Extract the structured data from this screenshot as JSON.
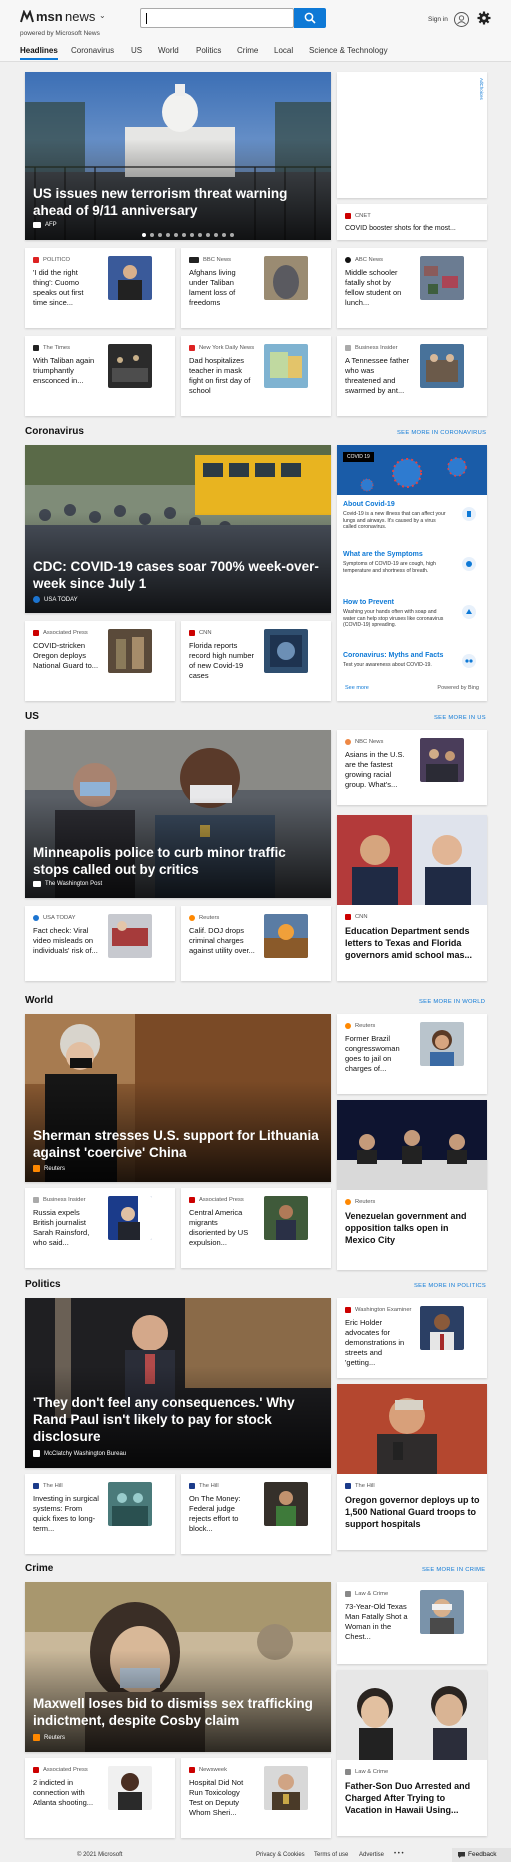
{
  "header": {
    "logo_msn": "msn",
    "logo_news": "news",
    "tagline": "powered by Microsoft News",
    "search": {
      "value": "",
      "placeholder": ""
    },
    "signin": "Sign in",
    "nav": [
      "Headlines",
      "Coronavirus",
      "US",
      "World",
      "Politics",
      "Crime",
      "Local",
      "Science & Technology"
    ]
  },
  "top": {
    "hero": {
      "title": "US issues new terrorism threat warning ahead of 9/11 anniversary",
      "source": "AFP"
    },
    "ad_label": "AdChoices",
    "side": {
      "source": "CNET",
      "title": "COVID booster shots for the most..."
    },
    "small": [
      {
        "source": "POLITICO",
        "title": "'I did the right thing': Cuomo speaks out first time since..."
      },
      {
        "source": "BBC News",
        "title": "Afghans living under Taliban lament loss of freedoms"
      },
      {
        "source": "ABC News",
        "title": "Middle schooler fatally shot by fellow student on lunch..."
      },
      {
        "source": "The Times",
        "title": "With Taliban again triumphantly ensconced in..."
      },
      {
        "source": "New York Daily News",
        "title": "Dad hospitalizes teacher in mask fight on first day of school"
      },
      {
        "source": "Business Insider",
        "title": "A Tennessee father who was threatened and swarmed by ant..."
      }
    ]
  },
  "coronavirus": {
    "heading": "Coronavirus",
    "see_more": "SEE MORE IN CORONAVIRUS",
    "hero": {
      "title": "CDC: COVID-19 cases soar 700% week-over-week since July 1",
      "source": "USA TODAY"
    },
    "small": [
      {
        "source": "Associated Press",
        "title": "COVID-stricken Oregon deploys National Guard to..."
      },
      {
        "source": "CNN",
        "title": "Florida reports record high number of new Covid-19 cases"
      }
    ],
    "info": {
      "badge": "COVID 19",
      "items": [
        {
          "title": "About Covid-19",
          "text": "Covid-19 is a new illness that can affect your lungs and airways. It's caused by a virus called coronavirus."
        },
        {
          "title": "What are the Symptoms",
          "text": "Symptoms of COVID-19 are cough, high temperature and shortness of breath."
        },
        {
          "title": "How to Prevent",
          "text": "Washing your hands often with soap and water can help stop viruses like coronavirus (COVID-19) spreading."
        },
        {
          "title": "Coronavirus: Myths and Facts",
          "text": "Test your awareness about COVID-19."
        }
      ],
      "see_more": "See more",
      "powered": "Powered by Bing"
    }
  },
  "us": {
    "heading": "US",
    "see_more": "SEE MORE IN US",
    "hero": {
      "title": "Minneapolis police to curb minor traffic stops called out by critics",
      "source": "The Washington Post"
    },
    "side_small": {
      "source": "NBC News",
      "title": "Asians in the U.S. are the fastest growing racial group. What's..."
    },
    "tall": {
      "source": "CNN",
      "title": "Education Department sends letters to Texas and Florida governors amid school mas..."
    },
    "small": [
      {
        "source": "USA TODAY",
        "title": "Fact check: Viral video misleads on individuals' risk of..."
      },
      {
        "source": "Reuters",
        "title": "Calif. DOJ drops criminal charges against utility over..."
      }
    ]
  },
  "world": {
    "heading": "World",
    "see_more": "SEE MORE IN WORLD",
    "hero": {
      "title": "Sherman stresses U.S. support for Lithuania against 'coercive' China",
      "source": "Reuters"
    },
    "side_small": {
      "source": "Reuters",
      "title": "Former Brazil congresswoman goes to jail on charges of..."
    },
    "tall": {
      "source": "Reuters",
      "title": "Venezuelan government and opposition talks open in Mexico City"
    },
    "small": [
      {
        "source": "Business Insider",
        "title": "Russia expels British journalist Sarah Rainsford, who said..."
      },
      {
        "source": "Associated Press",
        "title": "Central America migrants disoriented by US expulsion..."
      }
    ]
  },
  "politics": {
    "heading": "Politics",
    "see_more": "SEE MORE IN POLITICS",
    "hero": {
      "title": "'They don't feel any consequences.' Why Rand Paul isn't likely to pay for stock disclosure",
      "source": "McClatchy Washington Bureau"
    },
    "side_small": {
      "source": "Washington Examiner",
      "title": "Eric Holder advocates for demonstrations in streets and 'getting..."
    },
    "tall": {
      "source": "The Hill",
      "title": "Oregon governor deploys up to 1,500 National Guard troops to support hospitals"
    },
    "small": [
      {
        "source": "The Hill",
        "title": "Investing in surgical systems: From quick fixes to long-term..."
      },
      {
        "source": "The Hill",
        "title": "On The Money: Federal judge rejects effort to block..."
      }
    ]
  },
  "crime": {
    "heading": "Crime",
    "see_more": "SEE MORE IN CRIME",
    "hero": {
      "title": "Maxwell loses bid to dismiss sex trafficking indictment, despite Cosby claim",
      "source": "Reuters"
    },
    "side_small": {
      "source": "Law & Crime",
      "title": "73-Year-Old Texas Man Fatally Shot a Woman in the Chest..."
    },
    "tall": {
      "source": "Law & Crime",
      "title": "Father-Son Duo Arrested and Charged After Trying to Vacation in Hawaii Using..."
    },
    "small": [
      {
        "source": "Associated Press",
        "title": "2 indicted in connection with Atlanta shooting..."
      },
      {
        "source": "Newsweek",
        "title": "Hospital Did Not Run Toxicology Test on Deputy Whom Sheri..."
      }
    ]
  },
  "footer": {
    "copyright": "© 2021 Microsoft",
    "links": [
      "Privacy & Cookies",
      "Terms of use",
      "Advertise"
    ],
    "more": "• • •",
    "feedback": "Feedback"
  },
  "colors": {
    "accent": "#0e79d6",
    "page_bg": "#f0f0f0",
    "covid_banner": "#1a5ca8"
  }
}
